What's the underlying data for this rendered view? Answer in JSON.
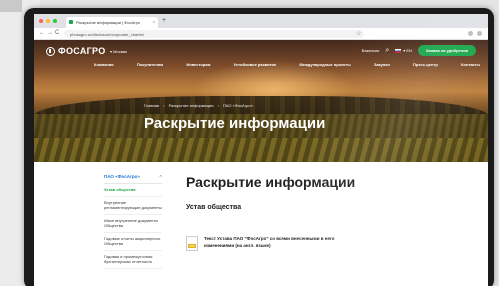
{
  "browser": {
    "tab_title": "Раскрытие информации | ФосАгро",
    "tab_close": "×",
    "new_tab": "+",
    "back": "←",
    "forward": "→",
    "reload": "C",
    "url": "phosagro.ru/disclosure/corporate_charter/",
    "star": "☆",
    "traffic_colors": [
      "#ff5f57",
      "#febc2e",
      "#28c840"
    ]
  },
  "header": {
    "logo": "ФОСАГРО",
    "region": "▾ Москва",
    "vacancies": "Вакансии",
    "search_icon": "⌕",
    "lang": "▾ EN",
    "cta": "Заявка на удобрения",
    "nav": [
      "Компания",
      "Покупателям",
      "Инвесторам",
      "Устойчивое развитие",
      "Международные проекты",
      "Закупки",
      "Пресс-центр",
      "Контакты"
    ]
  },
  "breadcrumb": [
    "Главная",
    "›",
    "Раскрытие информации",
    "›",
    "ПАО «ФосАгро»"
  ],
  "hero": {
    "title": "Раскрытие информации"
  },
  "sidebar": {
    "heading": "ПАО «ФосАгро»",
    "toggle": "^",
    "items": [
      {
        "label": "Устав общества",
        "active": true
      },
      {
        "label": "Внутренние регламентирующие документы",
        "active": false
      },
      {
        "label": "Иные внутренние документы Общества",
        "active": false
      },
      {
        "label": "Годовые отчеты акционерного Общества",
        "active": false
      },
      {
        "label": "Годовая и промежуточная бухгалтерская отчетность",
        "active": false
      }
    ]
  },
  "main": {
    "title": "Раскрытие информации",
    "subtitle": "Устав общества",
    "doc_text": "Текст Устава ПАО \"ФосАгро\" со всеми внесенными в него изменениями (на англ. языке)"
  },
  "colors": {
    "accent": "#19a54a",
    "link": "#1a73d9"
  }
}
